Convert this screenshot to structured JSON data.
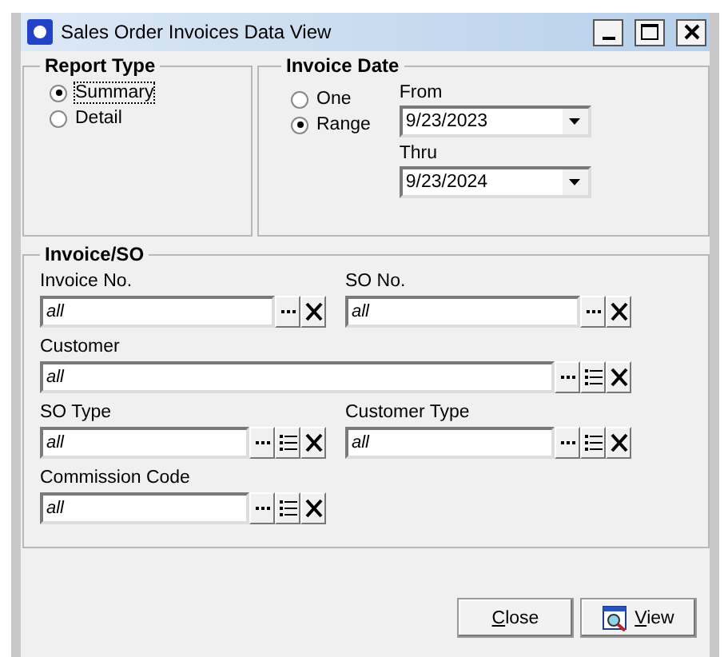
{
  "window": {
    "title": "Sales Order Invoices Data View"
  },
  "report_type": {
    "title": "Report Type",
    "options": [
      {
        "label": "Summary",
        "selected": true,
        "focused": true
      },
      {
        "label": "Detail",
        "selected": false,
        "focused": false
      }
    ]
  },
  "invoice_date": {
    "title": "Invoice Date",
    "options": [
      {
        "label": "One",
        "selected": false
      },
      {
        "label": "Range",
        "selected": true
      }
    ],
    "dates": [
      {
        "label": "From",
        "value": "9/23/2023"
      },
      {
        "label": "Thru",
        "value": "9/23/2024"
      }
    ]
  },
  "invoice_so": {
    "title": "Invoice/SO",
    "rows": [
      [
        {
          "label": "Invoice No.",
          "value": "all",
          "wide": false,
          "buttons": [
            {
              "kind": "browse"
            },
            {
              "kind": "clear"
            }
          ]
        },
        {
          "label": "SO No.",
          "value": "all",
          "wide": false,
          "buttons": [
            {
              "kind": "browse"
            },
            {
              "kind": "clear"
            }
          ]
        }
      ],
      [
        {
          "label": "Customer",
          "value": "all",
          "wide": true,
          "buttons": [
            {
              "kind": "browse"
            },
            {
              "kind": "list"
            },
            {
              "kind": "clear"
            }
          ]
        }
      ],
      [
        {
          "label": "SO Type",
          "value": "all",
          "wide": false,
          "buttons": [
            {
              "kind": "browse"
            },
            {
              "kind": "list"
            },
            {
              "kind": "clear"
            }
          ]
        },
        {
          "label": "Customer Type",
          "value": "all",
          "wide": false,
          "buttons": [
            {
              "kind": "browse"
            },
            {
              "kind": "list"
            },
            {
              "kind": "clear"
            }
          ]
        }
      ],
      [
        {
          "label": "Commission Code",
          "value": "all",
          "wide": false,
          "buttons": [
            {
              "kind": "browse"
            },
            {
              "kind": "list"
            },
            {
              "kind": "clear"
            }
          ]
        }
      ]
    ]
  },
  "buttons": [
    {
      "label": "Close",
      "kind": "plain"
    },
    {
      "label": "View",
      "kind": "view"
    }
  ]
}
